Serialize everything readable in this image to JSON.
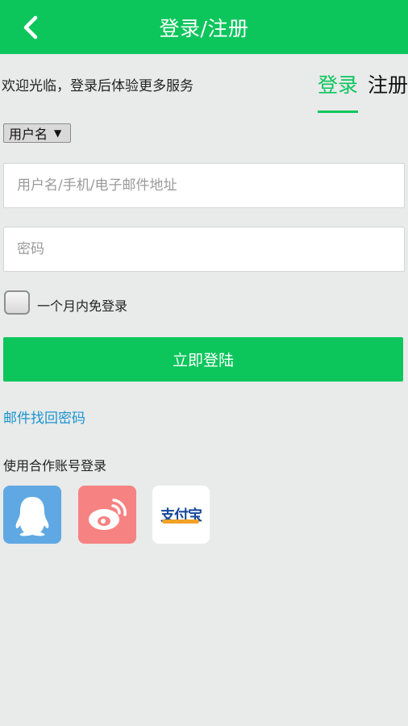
{
  "header": {
    "title": "登录/注册",
    "back_icon": "chevron-left-icon"
  },
  "welcome": "欢迎光临，登录后体验更多服务",
  "tabs": [
    {
      "label": "登录",
      "active": true
    },
    {
      "label": "注册",
      "active": false
    }
  ],
  "login_type": {
    "selected": "用户名",
    "arrow": "▼"
  },
  "form": {
    "username_placeholder": "用户名/手机/电子邮件地址",
    "password_placeholder": "密码",
    "remember_label": "一个月内免登录",
    "submit_label": "立即登陆"
  },
  "recover_link": "邮件找回密码",
  "partner_title": "使用合作账号登录",
  "partners": [
    {
      "name": "qq",
      "icon": "qq-penguin-icon"
    },
    {
      "name": "weibo",
      "icon": "weibo-icon"
    },
    {
      "name": "alipay",
      "icon": "alipay-logo-icon",
      "logo_text": "支付宝"
    }
  ],
  "colors": {
    "accent": "#0cc65c",
    "link": "#1a95cf",
    "background": "#e9eaea",
    "qq": "#5fa8e3",
    "weibo": "#f78282"
  }
}
